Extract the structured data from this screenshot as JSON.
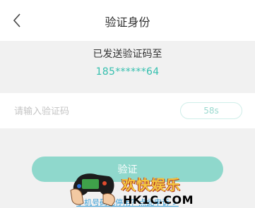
{
  "header": {
    "title": "验证身份",
    "back_icon": "chevron-left-icon"
  },
  "info": {
    "sent_text": "已发送验证码至",
    "phone_masked": "185******64"
  },
  "code_field": {
    "value": "",
    "placeholder": "请输入验证码",
    "countdown_label": "58s"
  },
  "actions": {
    "verify_label": "验证",
    "phone_unavailable_link": "手机号码已停用？点此申诉 >"
  },
  "watermark": {
    "line1": "欢快娱乐",
    "line2": "HK1C.COM"
  },
  "colors": {
    "accent": "#34bfae",
    "button_disabled": "#8fd8cc",
    "link": "#3a9fd6"
  }
}
